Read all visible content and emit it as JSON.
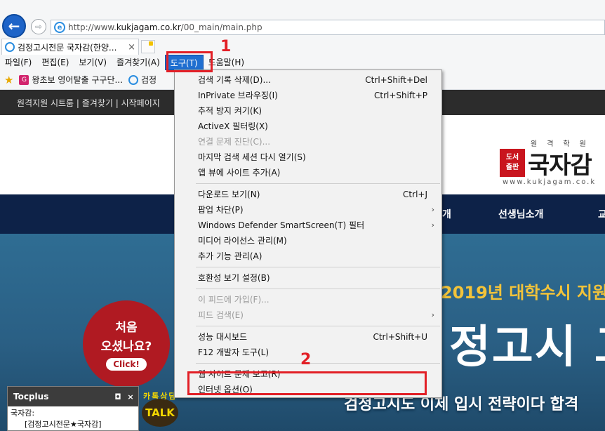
{
  "browser": {
    "address": "http://www.kukjagam.co.kr/00_main/main.php",
    "address_prefix": "http://www.",
    "address_domain": "kukjagam.co.kr",
    "address_path": "/00_main/main.php",
    "tab_title": "검정고시전문 국자감(한양...",
    "tab_close": "×"
  },
  "menubar": {
    "items": [
      "파일(F)",
      "편집(E)",
      "보기(V)",
      "즐겨찾기(A)",
      "도구(T)",
      "도움말(H)"
    ]
  },
  "favorites": {
    "items": [
      "왕초보 영어탈출 구구단...",
      "검정"
    ]
  },
  "site": {
    "topbar": "원격지원 시트룸 | 즐겨찾기 | 시작페이지",
    "logo_sub": "원격학원",
    "logo_box_top": "도서",
    "logo_box_bottom": "출판",
    "logo_name": "국자감",
    "logo_url": "www.kukjagam.co.k",
    "nav": [
      "개",
      "선생님소개",
      "교"
    ],
    "banner_line1": "2019년 대학수시 지원",
    "banner_line2": "정고시 고",
    "banner_line3": "검정고시도 이제 입시 전략이다 합격",
    "visit_line1": "처음",
    "visit_line2": "오셨나요?",
    "visit_button": "Click!",
    "talk_label": "카톡상담",
    "talk_text": "TALK"
  },
  "tocplus": {
    "title": "Tocplus",
    "min": "◘",
    "close": "×",
    "line1": "국자감:",
    "line2": "[검정고시전문★국자감]"
  },
  "tools_menu": {
    "groups": [
      [
        {
          "label": "검색 기록 삭제(D)...",
          "shortcut": "Ctrl+Shift+Del"
        },
        {
          "label": "InPrivate 브라우징(I)",
          "shortcut": "Ctrl+Shift+P"
        },
        {
          "label": "추적 방지 켜기(K)",
          "shortcut": ""
        },
        {
          "label": "ActiveX 필터링(X)",
          "shortcut": ""
        },
        {
          "label": "연결 문제 진단(C)...",
          "shortcut": "",
          "disabled": true
        },
        {
          "label": "마지막 검색 세션 다시 열기(S)",
          "shortcut": ""
        },
        {
          "label": "앱 뷰에 사이트 추가(A)",
          "shortcut": ""
        }
      ],
      [
        {
          "label": "다운로드 보기(N)",
          "shortcut": "Ctrl+J"
        },
        {
          "label": "팝업 차단(P)",
          "shortcut": "",
          "submenu": true
        },
        {
          "label": "Windows Defender SmartScreen(T) 필터",
          "shortcut": "",
          "submenu": true
        },
        {
          "label": "미디어 라이선스 관리(M)",
          "shortcut": ""
        },
        {
          "label": "추가 기능 관리(A)",
          "shortcut": ""
        }
      ],
      [
        {
          "label": "호환성 보기 설정(B)",
          "shortcut": ""
        }
      ],
      [
        {
          "label": "이 피드에 가입(F)...",
          "shortcut": "",
          "disabled": true
        },
        {
          "label": "피드 검색(E)",
          "shortcut": "",
          "disabled": true,
          "submenu": true
        }
      ],
      [
        {
          "label": "성능 대시보드",
          "shortcut": "Ctrl+Shift+U"
        },
        {
          "label": "F12 개발자 도구(L)",
          "shortcut": ""
        }
      ],
      [
        {
          "label": "웹 사이트 문제 보고(R)",
          "shortcut": ""
        },
        {
          "label": "인터넷 옵션(O)",
          "shortcut": ""
        }
      ]
    ]
  },
  "annotations": {
    "num1": "1",
    "num2": "2",
    "color": "#e21f26"
  }
}
